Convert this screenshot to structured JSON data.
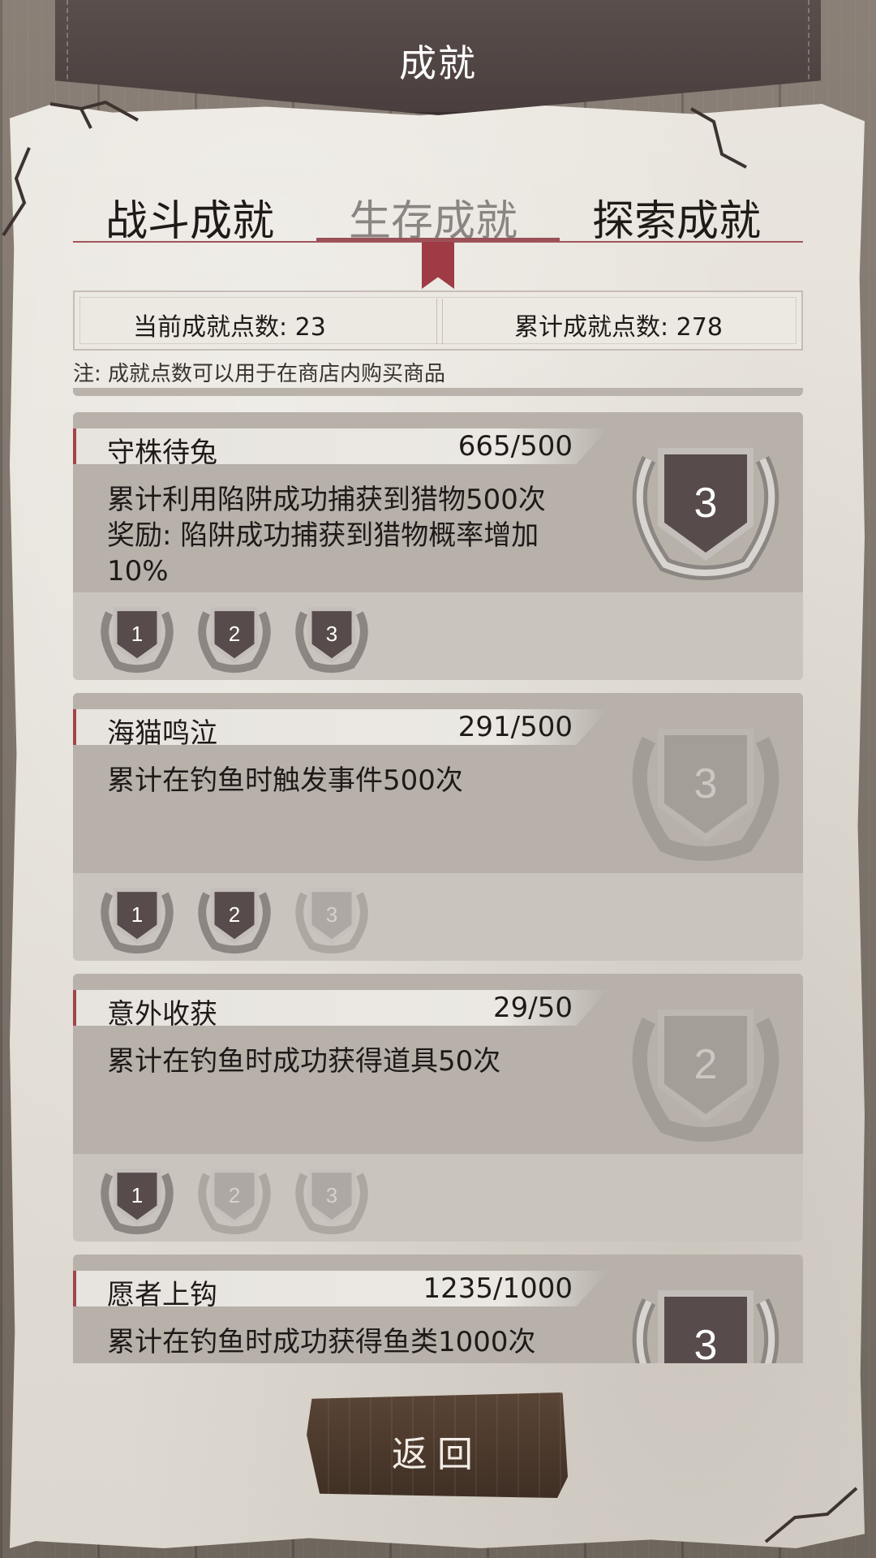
{
  "header": {
    "title": "成就"
  },
  "tabs": [
    {
      "label": "战斗成就",
      "active": false
    },
    {
      "label": "生存成就",
      "active": true
    },
    {
      "label": "探索成就",
      "active": false
    }
  ],
  "points": {
    "current": "当前成就点数: 23",
    "total": "累计成就点数: 278"
  },
  "note": "注: 成就点数可以用于在商店内购买商品",
  "achievements": [
    {
      "title": "守株待兔",
      "progress": "665/500",
      "description": "累计利用陷阱成功捕获到猎物500次",
      "reward": "奖励: 陷阱成功捕获到猎物概率增加10%",
      "big_medal": "3",
      "big_medal_achieved": true,
      "medals": [
        {
          "label": "1",
          "achieved": true
        },
        {
          "label": "2",
          "achieved": true
        },
        {
          "label": "3",
          "achieved": true
        }
      ]
    },
    {
      "title": "海猫鸣泣",
      "progress": "291/500",
      "description": "累计在钓鱼时触发事件500次",
      "reward": "",
      "big_medal": "3",
      "big_medal_achieved": false,
      "medals": [
        {
          "label": "1",
          "achieved": true
        },
        {
          "label": "2",
          "achieved": true
        },
        {
          "label": "3",
          "achieved": false
        }
      ]
    },
    {
      "title": "意外收获",
      "progress": "29/50",
      "description": "累计在钓鱼时成功获得道具50次",
      "reward": "",
      "big_medal": "2",
      "big_medal_achieved": false,
      "medals": [
        {
          "label": "1",
          "achieved": true
        },
        {
          "label": "2",
          "achieved": false
        },
        {
          "label": "3",
          "achieved": false
        }
      ]
    },
    {
      "title": "愿者上钩",
      "progress": "1235/1000",
      "description": "累计在钓鱼时成功获得鱼类1000次",
      "reward": "",
      "big_medal": "3",
      "big_medal_achieved": true,
      "medals": []
    }
  ],
  "back_button": {
    "label": "返回"
  },
  "colors": {
    "accent": "#9e3b44",
    "paper": "#e4e0d9",
    "card": "#b7b1aa",
    "header": "#4e4342"
  },
  "icons": {
    "medal": "laurel-shield-medal-icon"
  }
}
